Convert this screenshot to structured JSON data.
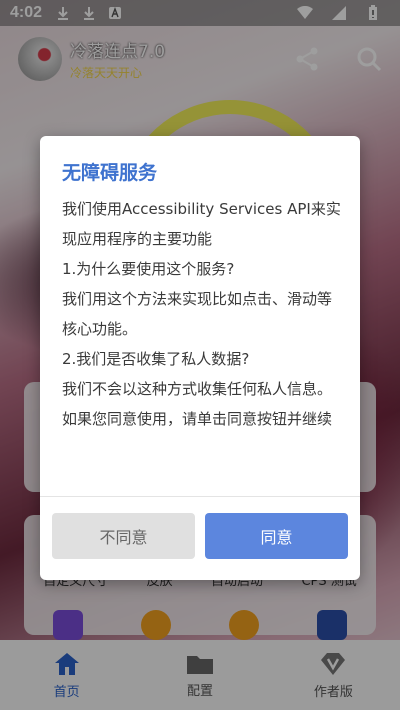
{
  "statusbar": {
    "time": "4:02"
  },
  "app": {
    "title": "冷落连点7.0",
    "subtitle": "冷落天天开心"
  },
  "shortcuts": [
    "自定义尺寸",
    "皮肤",
    "自动启动",
    "CPS 测试"
  ],
  "bottom_nav": [
    {
      "label": "首页",
      "icon": "home-icon",
      "active": true
    },
    {
      "label": "配置",
      "icon": "folder-icon",
      "active": false
    },
    {
      "label": "作者版",
      "icon": "diamond-v-icon",
      "active": false
    }
  ],
  "dialog": {
    "title": "无障碍服务",
    "paragraphs": [
      "我们使用Accessibility Services API来实现应用程序的主要功能",
      "1.为什么要使用这个服务?",
      "我们用这个方法来实现比如点击、滑动等核心功能。",
      "2.我们是否收集了私人数据?",
      "我们不会以这种方式收集任何私人信息。",
      "如果您同意使用，请单击同意按钮并继续"
    ],
    "disagree_label": "不同意",
    "agree_label": "同意"
  },
  "colors": {
    "accent": "#3f73cf",
    "agree_button": "#5c86de",
    "disagree_button": "#e0e0e0",
    "active_nav": "#2b62c9"
  }
}
